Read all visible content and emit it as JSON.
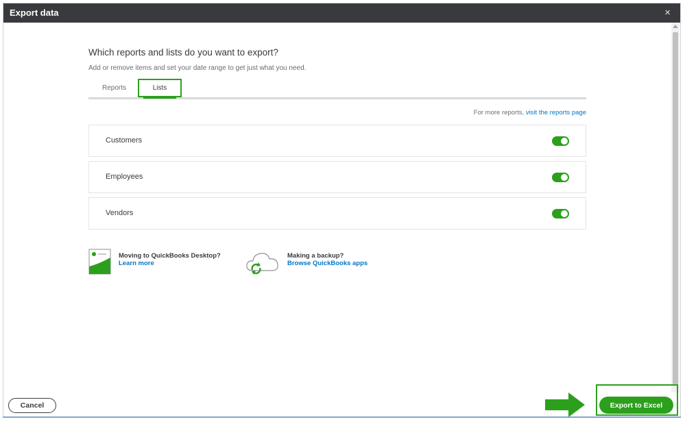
{
  "window": {
    "title": "Export data",
    "close_symbol": "×"
  },
  "main": {
    "heading": "Which reports and lists do you want to export?",
    "subheading": "Add or remove items and set your date range to get just what you need.",
    "tabs": [
      {
        "label": "Reports",
        "selected": false
      },
      {
        "label": "Lists",
        "selected": true
      }
    ],
    "more_reports": {
      "text": "For more reports, ",
      "link": "visit the reports page"
    },
    "lists": [
      {
        "label": "Customers",
        "enabled": true
      },
      {
        "label": "Employees",
        "enabled": true
      },
      {
        "label": "Vendors",
        "enabled": true
      }
    ],
    "promos": [
      {
        "title": "Moving to QuickBooks Desktop?",
        "link": "Learn more",
        "icon": "desktop-doc-icon"
      },
      {
        "title": "Making a backup?",
        "link": "Browse QuickBooks apps",
        "icon": "cloud-sync-icon"
      }
    ]
  },
  "footer": {
    "cancel_label": "Cancel",
    "export_label": "Export to Excel"
  },
  "colors": {
    "accent": "#2ca01c",
    "link": "#0077c5",
    "titlebar": "#393a3d"
  }
}
